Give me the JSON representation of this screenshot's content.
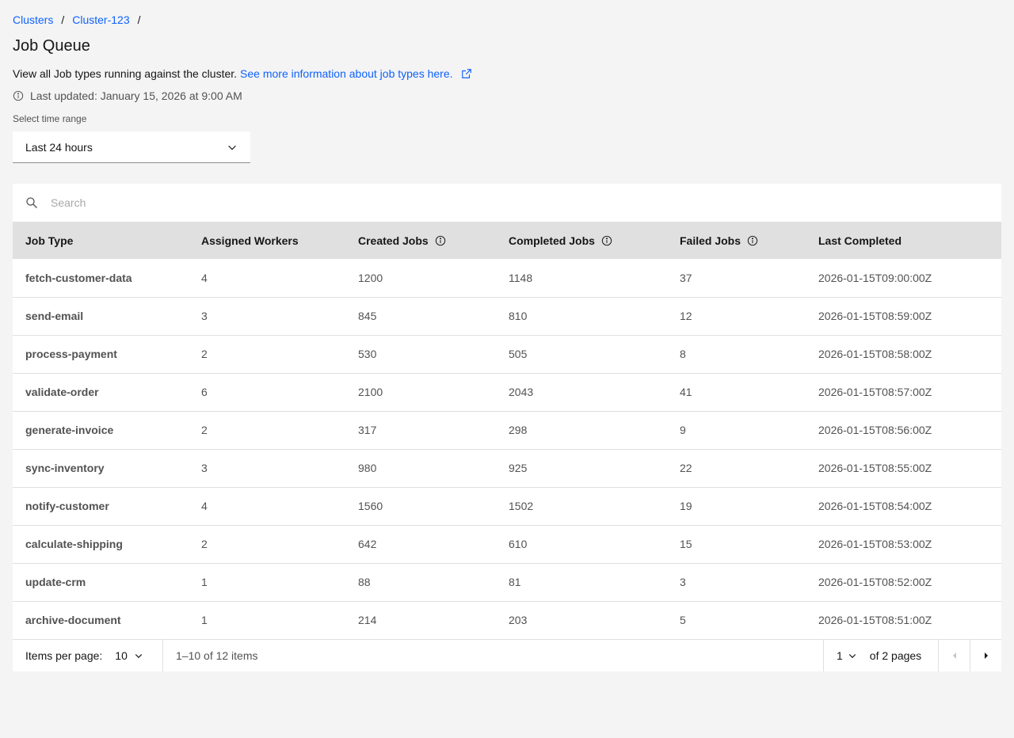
{
  "breadcrumb": {
    "items": [
      "Clusters",
      "Cluster-123"
    ],
    "separator": "/"
  },
  "page": {
    "title": "Job Queue",
    "description": "View all Job types running against the cluster.",
    "link_text": "See more information about job types here.",
    "last_updated": "Last updated: January 15, 2026 at 9:00 AM"
  },
  "time_range": {
    "label": "Select time range",
    "value": "Last 24 hours"
  },
  "search": {
    "placeholder": "Search"
  },
  "table": {
    "headers": [
      "Job Type",
      "Assigned Workers",
      "Created Jobs",
      "Completed Jobs",
      "Failed Jobs",
      "Last Completed"
    ],
    "rows": [
      [
        "fetch-customer-data",
        "4",
        "1200",
        "1148",
        "37",
        "2026-01-15T09:00:00Z"
      ],
      [
        "send-email",
        "3",
        "845",
        "810",
        "12",
        "2026-01-15T08:59:00Z"
      ],
      [
        "process-payment",
        "2",
        "530",
        "505",
        "8",
        "2026-01-15T08:58:00Z"
      ],
      [
        "validate-order",
        "6",
        "2100",
        "2043",
        "41",
        "2026-01-15T08:57:00Z"
      ],
      [
        "generate-invoice",
        "2",
        "317",
        "298",
        "9",
        "2026-01-15T08:56:00Z"
      ],
      [
        "sync-inventory",
        "3",
        "980",
        "925",
        "22",
        "2026-01-15T08:55:00Z"
      ],
      [
        "notify-customer",
        "4",
        "1560",
        "1502",
        "19",
        "2026-01-15T08:54:00Z"
      ],
      [
        "calculate-shipping",
        "2",
        "642",
        "610",
        "15",
        "2026-01-15T08:53:00Z"
      ],
      [
        "update-crm",
        "1",
        "88",
        "81",
        "3",
        "2026-01-15T08:52:00Z"
      ],
      [
        "archive-document",
        "1",
        "214",
        "203",
        "5",
        "2026-01-15T08:51:00Z"
      ]
    ]
  },
  "pagination": {
    "items_per_page_label": "Items per page:",
    "items_per_page": "10",
    "range": "1–10 of 12 items",
    "page": "1",
    "of_pages": "of 2 pages"
  },
  "icons": {
    "external": "external-link-icon",
    "info": "info-icon",
    "chevron": "chevron-down-icon",
    "search": "search-icon",
    "prev": "caret-left-icon",
    "next": "caret-right-icon"
  },
  "colors": {
    "link": "#0f62fe",
    "header_bg": "#e0e0e0",
    "page_bg": "#f4f4f4"
  }
}
